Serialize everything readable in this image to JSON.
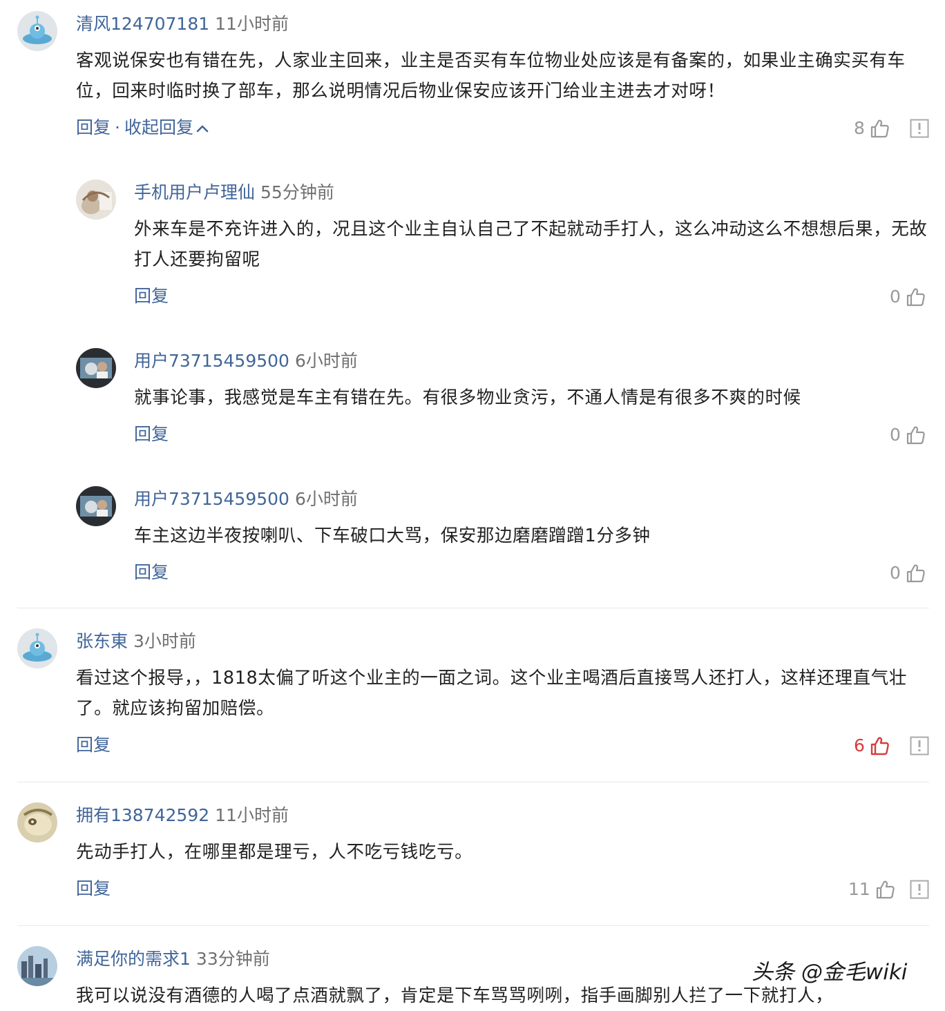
{
  "comments": [
    {
      "user": "清风124707181",
      "time": "11小时前",
      "text": "客观说保安也有错在先，人家业主回来，业主是否买有车位物业处应该是有备案的，如果业主确实买有车位，回来时临时换了部车，那么说明情况后物业保安应该开门给业主进去才对呀！",
      "reply_label": "回复",
      "separator": "·",
      "collapse_label": "收起回复",
      "likes": "8",
      "avatar_icon": "alien-avatar-icon",
      "replies": [
        {
          "user": "手机用户卢理仙",
          "time": "55分钟前",
          "text": "外来车是不充许进入的，况且这个业主自认自己了不起就动手打人，这么冲动这么不想想后果，无故打人还要拘留呢",
          "reply_label": "回复",
          "likes": "0"
        },
        {
          "user": "用户73715459500",
          "time": "6小时前",
          "text": "就事论事，我感觉是车主有错在先。有很多物业贪污，不通人情是有很多不爽的时候",
          "reply_label": "回复",
          "likes": "0"
        },
        {
          "user": "用户73715459500",
          "time": "6小时前",
          "text": "车主这边半夜按喇叭、下车破口大骂，保安那边磨磨蹭蹭1分多钟",
          "reply_label": "回复",
          "likes": "0"
        }
      ]
    },
    {
      "user": "张东東",
      "time": "3小时前",
      "text": "看过这个报导，，1818太偏了听这个业主的一面之词。这个业主喝酒后直接骂人还打人，这样还理直气壮了。就应该拘留加赔偿。",
      "reply_label": "回复",
      "likes": "6",
      "liked": true
    },
    {
      "user": "拥有138742592",
      "time": "11小时前",
      "text": "先动手打人，在哪里都是理亏，人不吃亏钱吃亏。",
      "reply_label": "回复",
      "likes": "11"
    },
    {
      "user": "满足你的需求1",
      "time": "33分钟前",
      "text": "我可以说没有酒德的人喝了点酒就飘了，肯定是下车骂骂咧咧，指手画脚别人拦了一下就打人，"
    }
  ],
  "watermark": "头条 @金毛wiki",
  "colors": {
    "username": "#406599",
    "action_link": "#406599",
    "timestamp": "#707070",
    "like_inactive": "#999999",
    "like_active": "#d43d3d",
    "divider": "#e8e8e8"
  }
}
